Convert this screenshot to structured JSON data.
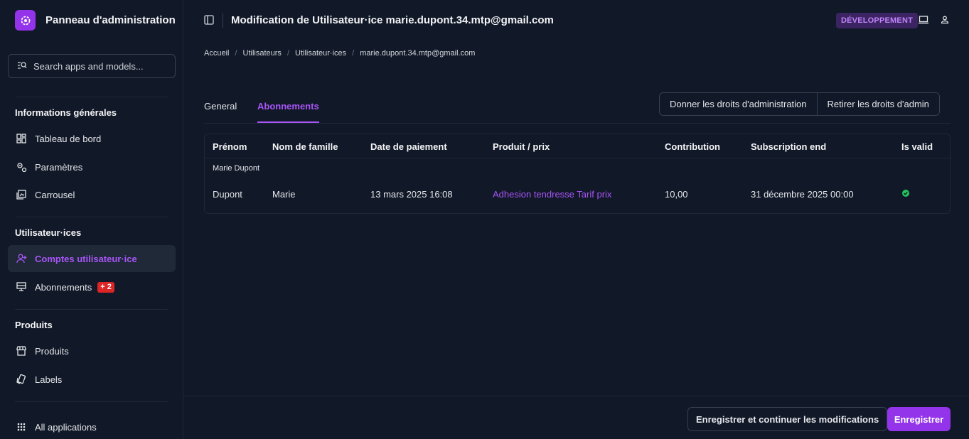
{
  "app": {
    "title": "Panneau d'administration"
  },
  "search": {
    "placeholder": "Search apps and models..."
  },
  "sidebar": {
    "sections": [
      {
        "title": "Informations générales",
        "items": [
          {
            "label": "Tableau de bord",
            "icon": "dashboard-icon"
          },
          {
            "label": "Paramètres",
            "icon": "settings-icon"
          },
          {
            "label": "Carrousel",
            "icon": "carousel-icon"
          }
        ]
      },
      {
        "title": "Utilisateur·ices",
        "items": [
          {
            "label": "Comptes utilisateur·ice",
            "icon": "person-add-icon",
            "active": true
          },
          {
            "label": "Abonnements",
            "icon": "subscriptions-icon",
            "badge": "+ 2"
          }
        ]
      },
      {
        "title": "Produits",
        "items": [
          {
            "label": "Produits",
            "icon": "store-icon"
          },
          {
            "label": "Labels",
            "icon": "label-icon"
          }
        ]
      }
    ],
    "all_apps": "All applications"
  },
  "header": {
    "title": "Modification de Utilisateur·ice marie.dupont.34.mtp@gmail.com",
    "env_badge": "DÉVELOPPEMENT"
  },
  "breadcrumb": [
    "Accueil",
    "Utilisateurs",
    "Utilisateur·ices",
    "marie.dupont.34.mtp@gmail.com"
  ],
  "tabs": [
    {
      "label": "General"
    },
    {
      "label": "Abonnements",
      "active": true
    }
  ],
  "actions": {
    "grant_admin": "Donner les droits d'administration",
    "revoke_admin": "Retirer les droits d'admin"
  },
  "table": {
    "columns": [
      "Prénom",
      "Nom de famille",
      "Date de paiement",
      "Produit / prix",
      "Contribution",
      "Subscription end",
      "Is valid"
    ],
    "group_label": "Marie Dupont",
    "rows": [
      {
        "prenom": "Dupont",
        "nom": "Marie",
        "date": "13 mars 2025 16:08",
        "produit": "Adhesion tendresse Tarif prix",
        "contribution": "10,00",
        "end": "31 décembre 2025 00:00",
        "valid": true
      }
    ]
  },
  "footer": {
    "save_continue": "Enregistrer et continuer les modifications",
    "save": "Enregistrer"
  },
  "colors": {
    "accent": "#a855f7",
    "badge_red": "#dc2626",
    "valid_green": "#22c55e"
  }
}
